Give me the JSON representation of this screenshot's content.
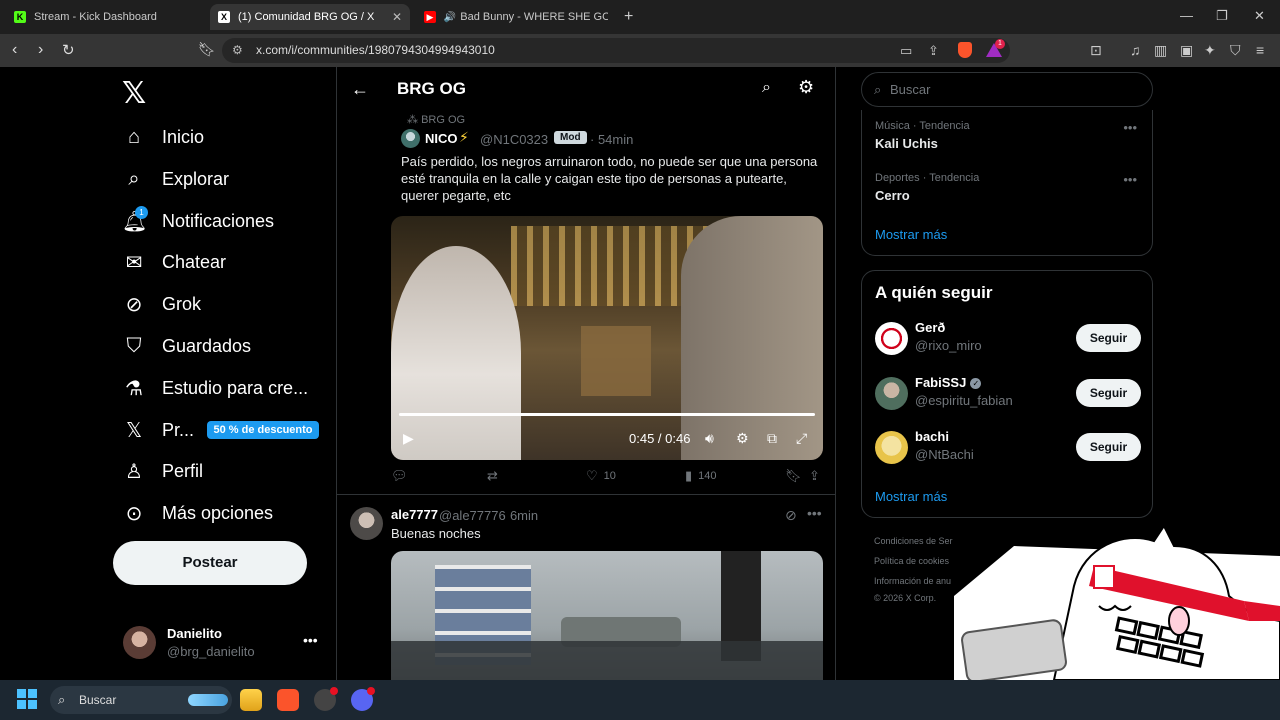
{
  "browser": {
    "tabs": [
      {
        "label": "Stream - Kick Dashboard",
        "favicon": "K",
        "active": false
      },
      {
        "label": "(1) Comunidad BRG OG / X",
        "favicon": "X",
        "active": true
      },
      {
        "label": "Bad Bunny - WHERE SHE GOES (V",
        "favicon": "▶",
        "active": false
      }
    ],
    "url": "x.com/i/communities/1980794304994943010",
    "bat_count": "1"
  },
  "sidebar": {
    "items": [
      {
        "label": "Inicio",
        "icon": "home-icon"
      },
      {
        "label": "Explorar",
        "icon": "search-icon"
      },
      {
        "label": "Notificaciones",
        "icon": "bell-icon"
      },
      {
        "label": "Chatear",
        "icon": "mail-icon"
      },
      {
        "label": "Grok",
        "icon": "grok-icon"
      },
      {
        "label": "Guardados",
        "icon": "bookmark-icon"
      },
      {
        "label": "Estudio para cre...",
        "icon": "flask-icon"
      },
      {
        "label": "Pr...",
        "icon": "x-premium-icon"
      },
      {
        "label": "Perfil",
        "icon": "person-icon"
      },
      {
        "label": "Más opciones",
        "icon": "more-circle-icon"
      }
    ],
    "notification_count": "1",
    "premium_badge": "50 % de descuento",
    "post_button": "Postear",
    "account": {
      "name": "Danielito",
      "handle": "@brg_danielito"
    }
  },
  "header": {
    "title": "BRG OG"
  },
  "tweets": [
    {
      "community": "BRG OG",
      "name": "NICO",
      "handle": "@N1C0323",
      "badge": "Mod",
      "time": "· 54min",
      "text": "País perdido, los negros arruinaron todo, no puede ser que una persona esté tranquila en la calle y caigan este tipo de personas a putearte, querer pegarte, etc",
      "video_time": "0:45 / 0:46",
      "likes": "10",
      "views": "140"
    },
    {
      "name": "ale7777",
      "handle": "@ale77776",
      "time": "· 6min",
      "text": "Buenas noches"
    }
  ],
  "right": {
    "search_placeholder": "Buscar",
    "trends": [
      {
        "meta": "Música · Tendencia",
        "name": "Kali Uchis"
      },
      {
        "meta": "Deportes · Tendencia",
        "name": "Cerro"
      }
    ],
    "show_more": "Mostrar más",
    "who_title": "A quién seguir",
    "who": [
      {
        "name": "Gerð",
        "handle": "@rixo_miro",
        "verified": false
      },
      {
        "name": "FabiSSJ",
        "handle": "@espiritu_fabian",
        "verified": true
      },
      {
        "name": "bachi",
        "handle": "@NtBachi",
        "verified": false
      }
    ],
    "follow_label": "Seguir",
    "footer": [
      "Condiciones de Ser",
      "Política de cookies",
      "Información de anu",
      "© 2026 X Corp."
    ]
  },
  "taskbar": {
    "search_label": "Buscar"
  }
}
